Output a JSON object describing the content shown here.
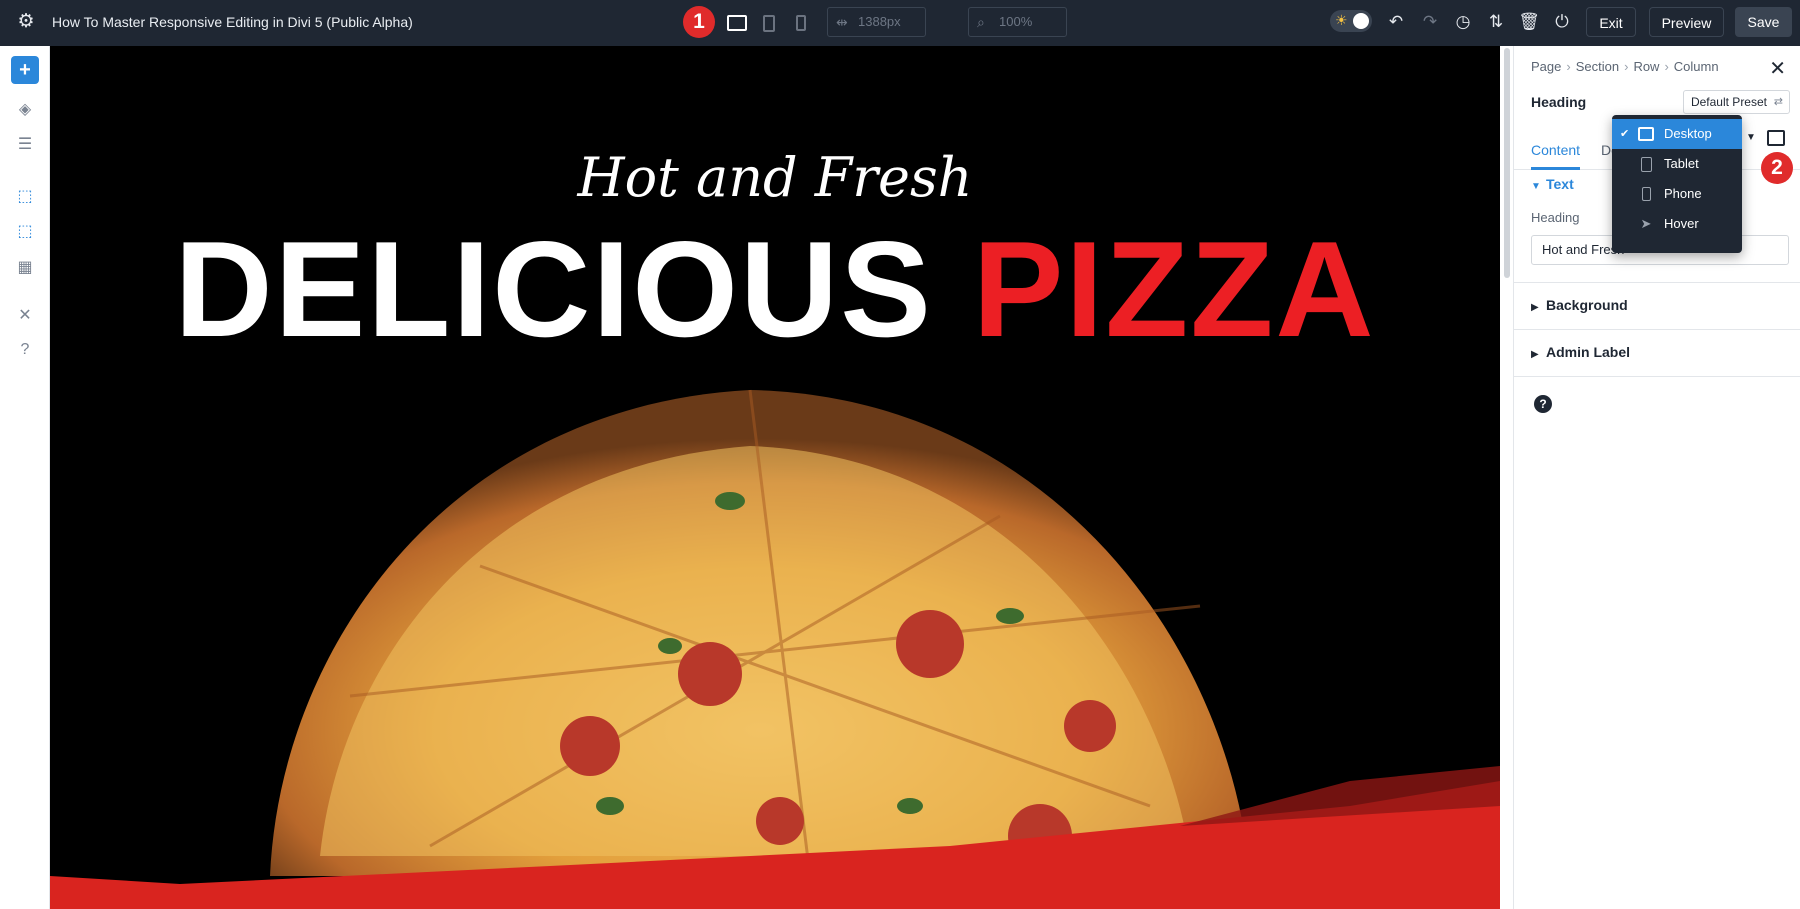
{
  "topbar": {
    "page_title": "How To Master Responsive Editing in Divi 5 (Public Alpha)",
    "step_badge_1": "1",
    "width_value": "1388px",
    "zoom_value": "100%",
    "exit_label": "Exit",
    "preview_label": "Preview",
    "save_label": "Save"
  },
  "canvas": {
    "script_heading": "Hot and Fresh",
    "headline_white": "DELICIOUS",
    "headline_red": "PIZZA",
    "colors": {
      "background": "#000000",
      "accent_red": "#ec1f24",
      "wave_red": "#d9241f"
    }
  },
  "panel": {
    "breadcrumb": [
      "Page",
      "Section",
      "Row",
      "Column"
    ],
    "module_title": "Heading",
    "preset_label": "Default Preset",
    "tabs": [
      {
        "label": "Content"
      },
      {
        "label": "De"
      }
    ],
    "step_badge_2": "2",
    "text_section": "Text",
    "heading_label": "Heading",
    "heading_value": "Hot and Fresh",
    "background_section": "Background",
    "admin_label_section": "Admin Label",
    "help_icon": "?"
  },
  "device_menu": {
    "items": [
      {
        "label": "Desktop",
        "icon": "desktop-icon",
        "selected": true
      },
      {
        "label": "Tablet",
        "icon": "tablet-icon",
        "selected": false
      },
      {
        "label": "Phone",
        "icon": "phone-icon",
        "selected": false
      },
      {
        "label": "Hover",
        "icon": "cursor-icon",
        "selected": false
      }
    ]
  },
  "colors": {
    "topbar": "#1f2733",
    "accent_blue": "#2b87da",
    "badge_red": "#e02b2b"
  }
}
